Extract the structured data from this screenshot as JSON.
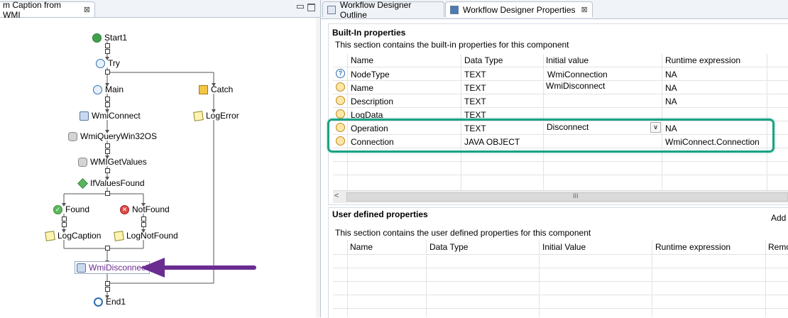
{
  "left_tab": {
    "title": "m Caption from WMI",
    "close": "⊠"
  },
  "right_tabs": [
    {
      "label": "Workflow Designer Outline"
    },
    {
      "label": "Workflow Designer Properties",
      "close": "⊠"
    }
  ],
  "workflow": {
    "nodes": {
      "start": "Start1",
      "try": "Try",
      "main": "Main",
      "catch": "Catch",
      "wmiconnect": "WmiConnect",
      "logerror": "LogError",
      "wmiquery": "WmiQueryWin32OS",
      "wmigetvalues": "WMIGetValues",
      "ifvaluesfound": "IfValuesFound",
      "found": "Found",
      "notfound": "NotFound",
      "logcaption": "LogCaption",
      "lognotfound": "LogNotFound",
      "wmidisconnect": "WmiDisconnect",
      "end": "End1"
    }
  },
  "builtin": {
    "title": "Built-In properties",
    "description": "This section contains the built-in properties for this component",
    "columns": [
      "Name",
      "Data Type",
      "Initial value",
      "Runtime expression"
    ],
    "rows": [
      {
        "icon": "question-icon",
        "name": "NodeType",
        "type": "TEXT",
        "initial": "WmiConnection",
        "runtime": "NA"
      },
      {
        "icon": "expression-icon",
        "name": "Name",
        "type": "TEXT",
        "initial": "WmiDisconnect",
        "runtime": "NA"
      },
      {
        "icon": "expression-icon",
        "name": "Description",
        "type": "TEXT",
        "initial": "",
        "runtime": "NA"
      },
      {
        "icon": "expression-icon",
        "name": "LogData",
        "type": "TEXT",
        "initial": "",
        "runtime": ""
      },
      {
        "icon": "expression-icon",
        "name": "Operation",
        "type": "TEXT",
        "initial": "Disconnect",
        "runtime": "NA"
      },
      {
        "icon": "expression-icon",
        "name": "Connection",
        "type": "JAVA OBJECT",
        "initial": "",
        "runtime": "WmiConnect.Connection"
      }
    ],
    "scroll_left": "<",
    "scroll_thumb": "III"
  },
  "userdef": {
    "title": "User defined properties",
    "add_label": "Add",
    "description": "This section contains the user defined properties for this component",
    "columns": [
      "Name",
      "Data Type",
      "Initial Value",
      "Runtime expression",
      "Remo"
    ]
  },
  "colors": {
    "highlight": "#1aa384",
    "arrow": "#6a2c91",
    "grid": "#e3e3e3",
    "tab_border": "#b9c3cf"
  }
}
